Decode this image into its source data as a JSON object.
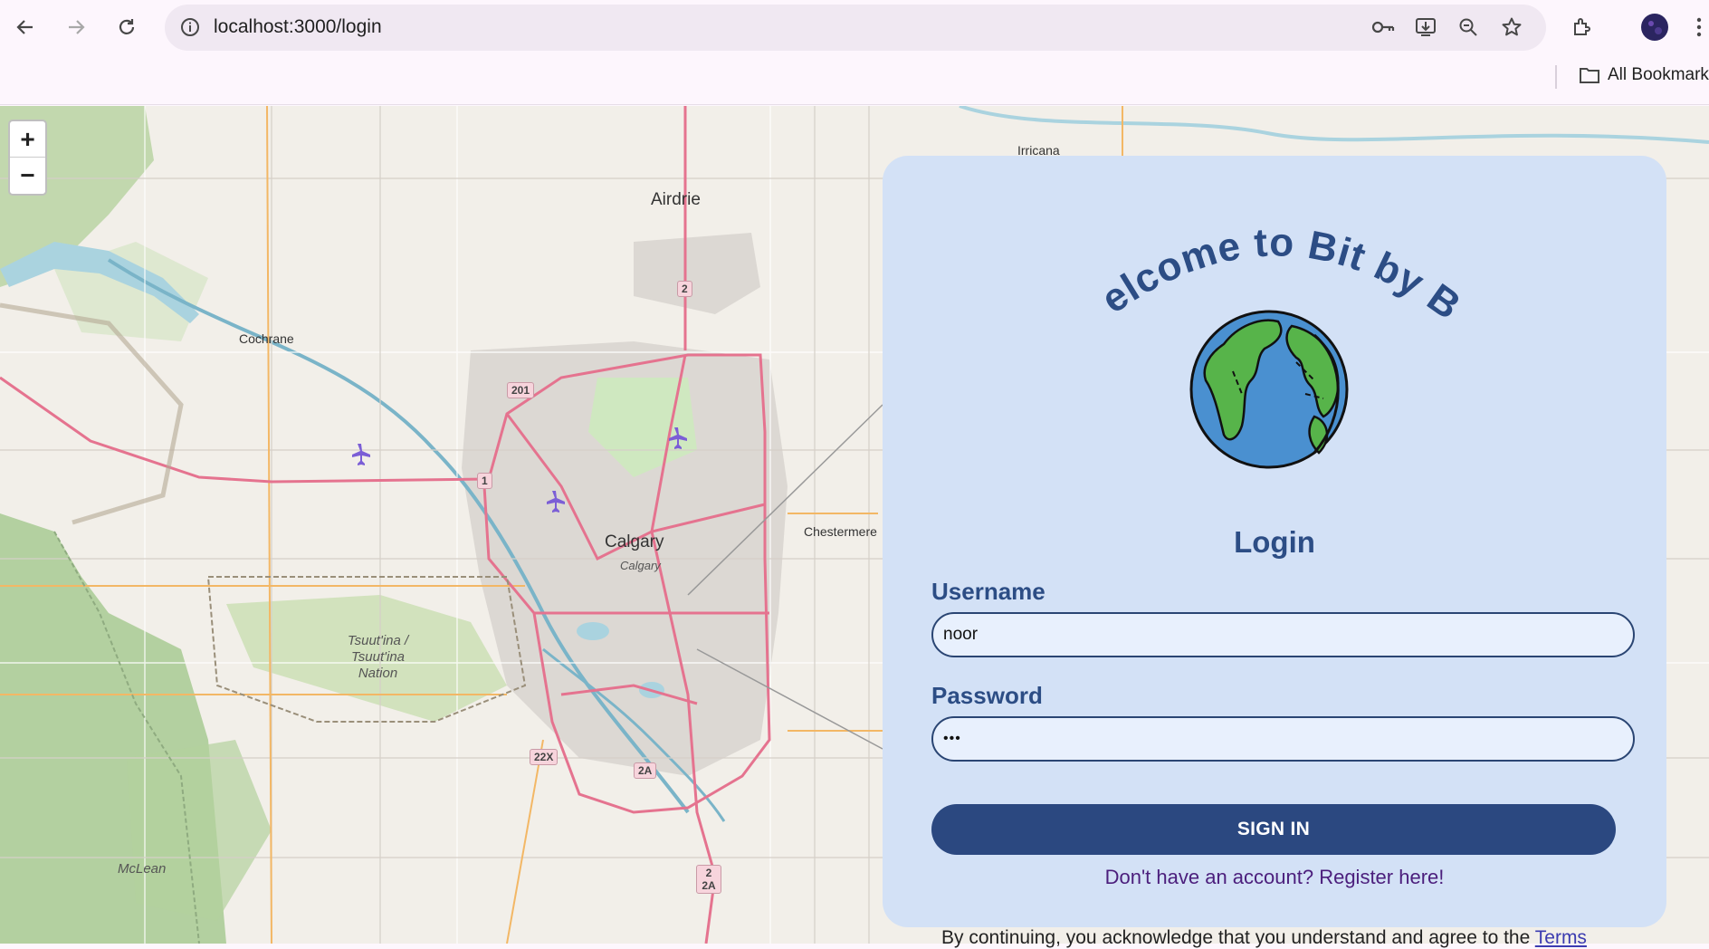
{
  "browser": {
    "url": "localhost:3000/login",
    "bookmarks_label": "All Bookmarks"
  },
  "map": {
    "labels": {
      "airdrie": "Airdrie",
      "cochrane": "Cochrane",
      "calgary": "Calgary",
      "calgary_sub": "Calgary",
      "chestermere": "Chestermere",
      "irricana": "Irricana",
      "tsuutina": "Tsuut'ina / Tsuut'ina Nation",
      "mclean": "McLean"
    },
    "shields": {
      "r201": "201",
      "r1": "1",
      "r2": "2",
      "r22x": "22X",
      "r2a": "2A",
      "r2_2a": "2 2A"
    },
    "zoom_in": "+",
    "zoom_out": "−"
  },
  "login": {
    "welcome": "Welcome to Bit by Bit",
    "title": "Login",
    "username_label": "Username",
    "username_value": "noor",
    "password_label": "Password",
    "password_value": "•••",
    "signin_label": "SIGN IN",
    "register_link": "Don't have an account? Register here!",
    "terms_text": "By continuing, you acknowledge that you understand and agree to the",
    "terms_link": "Terms"
  }
}
